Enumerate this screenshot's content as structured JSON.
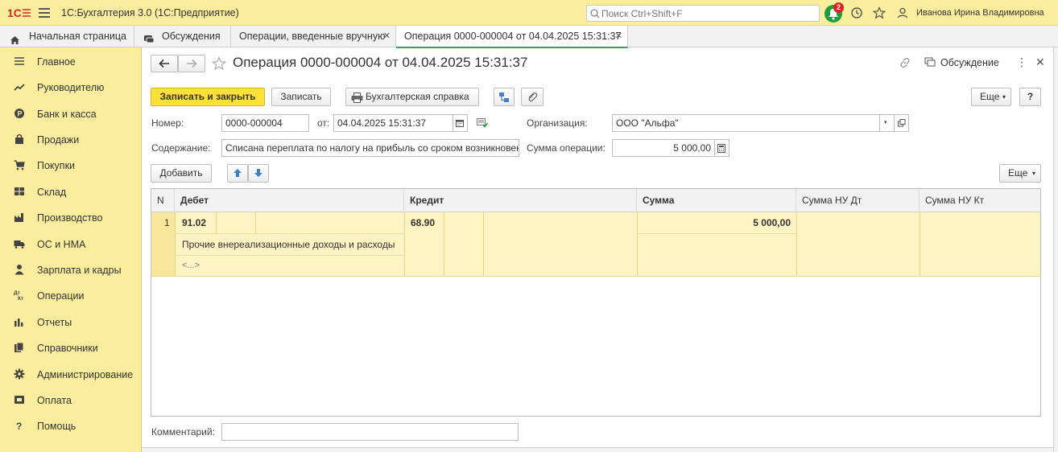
{
  "titlebar": {
    "app_title": "1С:Бухгалтерия 3.0  (1С:Предприятие)",
    "search_placeholder": "Поиск Ctrl+Shift+F",
    "notifications_count": "2",
    "user_name": "Иванова Ирина Владимировна",
    "icons": [
      "logo-1c-icon",
      "menu-icon",
      "search-icon",
      "notification-bell-icon",
      "history-icon",
      "favorites-star-icon",
      "user-icon"
    ]
  },
  "tabs": [
    {
      "label": "Начальная страница",
      "icon": "home-icon"
    },
    {
      "label": "Обсуждения",
      "icon": "chat-icon"
    },
    {
      "label": "Операции, введенные вручную",
      "closable": true
    },
    {
      "label": "Операция 0000-000004 от 04.04.2025 15:31:37",
      "closable": true,
      "active": true
    }
  ],
  "sidebar": {
    "items": [
      {
        "label": "Главное",
        "icon": "list-icon"
      },
      {
        "label": "Руководителю",
        "icon": "trend-icon"
      },
      {
        "label": "Банк и касса",
        "icon": "coin-icon"
      },
      {
        "label": "Продажи",
        "icon": "bag-icon"
      },
      {
        "label": "Покупки",
        "icon": "cart-icon"
      },
      {
        "label": "Склад",
        "icon": "warehouse-icon"
      },
      {
        "label": "Производство",
        "icon": "factory-icon"
      },
      {
        "label": "ОС и НМА",
        "icon": "truck-icon"
      },
      {
        "label": "Зарплата и кадры",
        "icon": "person-icon"
      },
      {
        "label": "Операции",
        "icon": "dt-kt-icon"
      },
      {
        "label": "Отчеты",
        "icon": "bar-chart-icon"
      },
      {
        "label": "Справочники",
        "icon": "books-icon"
      },
      {
        "label": "Администрирование",
        "icon": "gear-icon"
      },
      {
        "label": "Оплата",
        "icon": "payment-icon"
      },
      {
        "label": "Помощь",
        "icon": "question-icon"
      }
    ]
  },
  "form": {
    "title": "Операция 0000-000004 от 04.04.2025 15:31:37",
    "discussion_label": "Обсуждение",
    "buttons": {
      "save_close": "Записать и закрыть",
      "save": "Записать",
      "accounting_report": "Бухгалтерская справка",
      "more": "Еще",
      "more_arrow": "▾",
      "help": "?",
      "add": "Добавить",
      "more_table": "Еще"
    },
    "number_label": "Номер:",
    "number_value": "0000-000004",
    "date_label": "от:",
    "date_value": "04.04.2025 15:31:37",
    "org_label": "Организация:",
    "org_value": "ООО \"Альфа\"",
    "content_label": "Содержание:",
    "content_value": "Списана переплата по налогу на прибыль со сроком возникновения",
    "amount_label": "Сумма операции:",
    "amount_value": "5 000,00",
    "comment_label": "Комментарий:",
    "comment_value": ""
  },
  "table": {
    "headers": {
      "n": "N",
      "debit": "Дебет",
      "credit": "Кредит",
      "sum": "Сумма",
      "sum_nu_dt": "Сумма НУ Дт",
      "sum_nu_kt": "Сумма НУ Кт"
    },
    "rows": [
      {
        "n": "1",
        "debit_account": "91.02",
        "debit_subconto1": "Прочие внереализационные доходы и расходы",
        "debit_subconto2": "<...>",
        "credit_account": "68.90",
        "sum": "5 000,00",
        "sum_nu_dt": "",
        "sum_nu_kt": ""
      }
    ]
  },
  "colors": {
    "header_bg": "#fbed9e",
    "primary_button": "#fbe038",
    "selected_row": "#fdf3c3",
    "active_tab_underline": "#3f9f53"
  }
}
